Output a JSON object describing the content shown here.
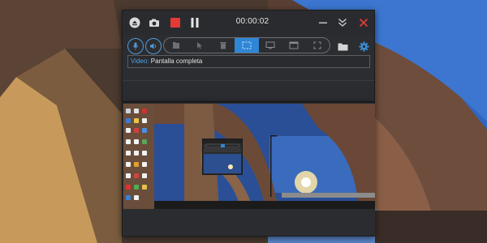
{
  "recorder": {
    "timer": "00:00:02",
    "source": {
      "label": "Video:",
      "value": "Pantalla completa"
    },
    "icons": {
      "title_left": [
        "eject-icon",
        "camera-icon",
        "record-stop-icon",
        "pause-icon"
      ],
      "title_right": [
        "minimize-icon",
        "collapse-icon",
        "close-icon"
      ],
      "left_circle": [
        "microphone-icon",
        "speaker-icon"
      ],
      "modes": [
        "folder-crop-icon",
        "cursor-icon",
        "trash-icon",
        "selection-icon",
        "monitor-icon",
        "window-icon",
        "fullscreen-icon"
      ],
      "right": [
        "folder-icon",
        "settings-icon"
      ]
    },
    "active_mode_index": 3,
    "colors": {
      "accent": "#2f86d6",
      "record": "#e53935",
      "close": "#e0403a"
    }
  }
}
